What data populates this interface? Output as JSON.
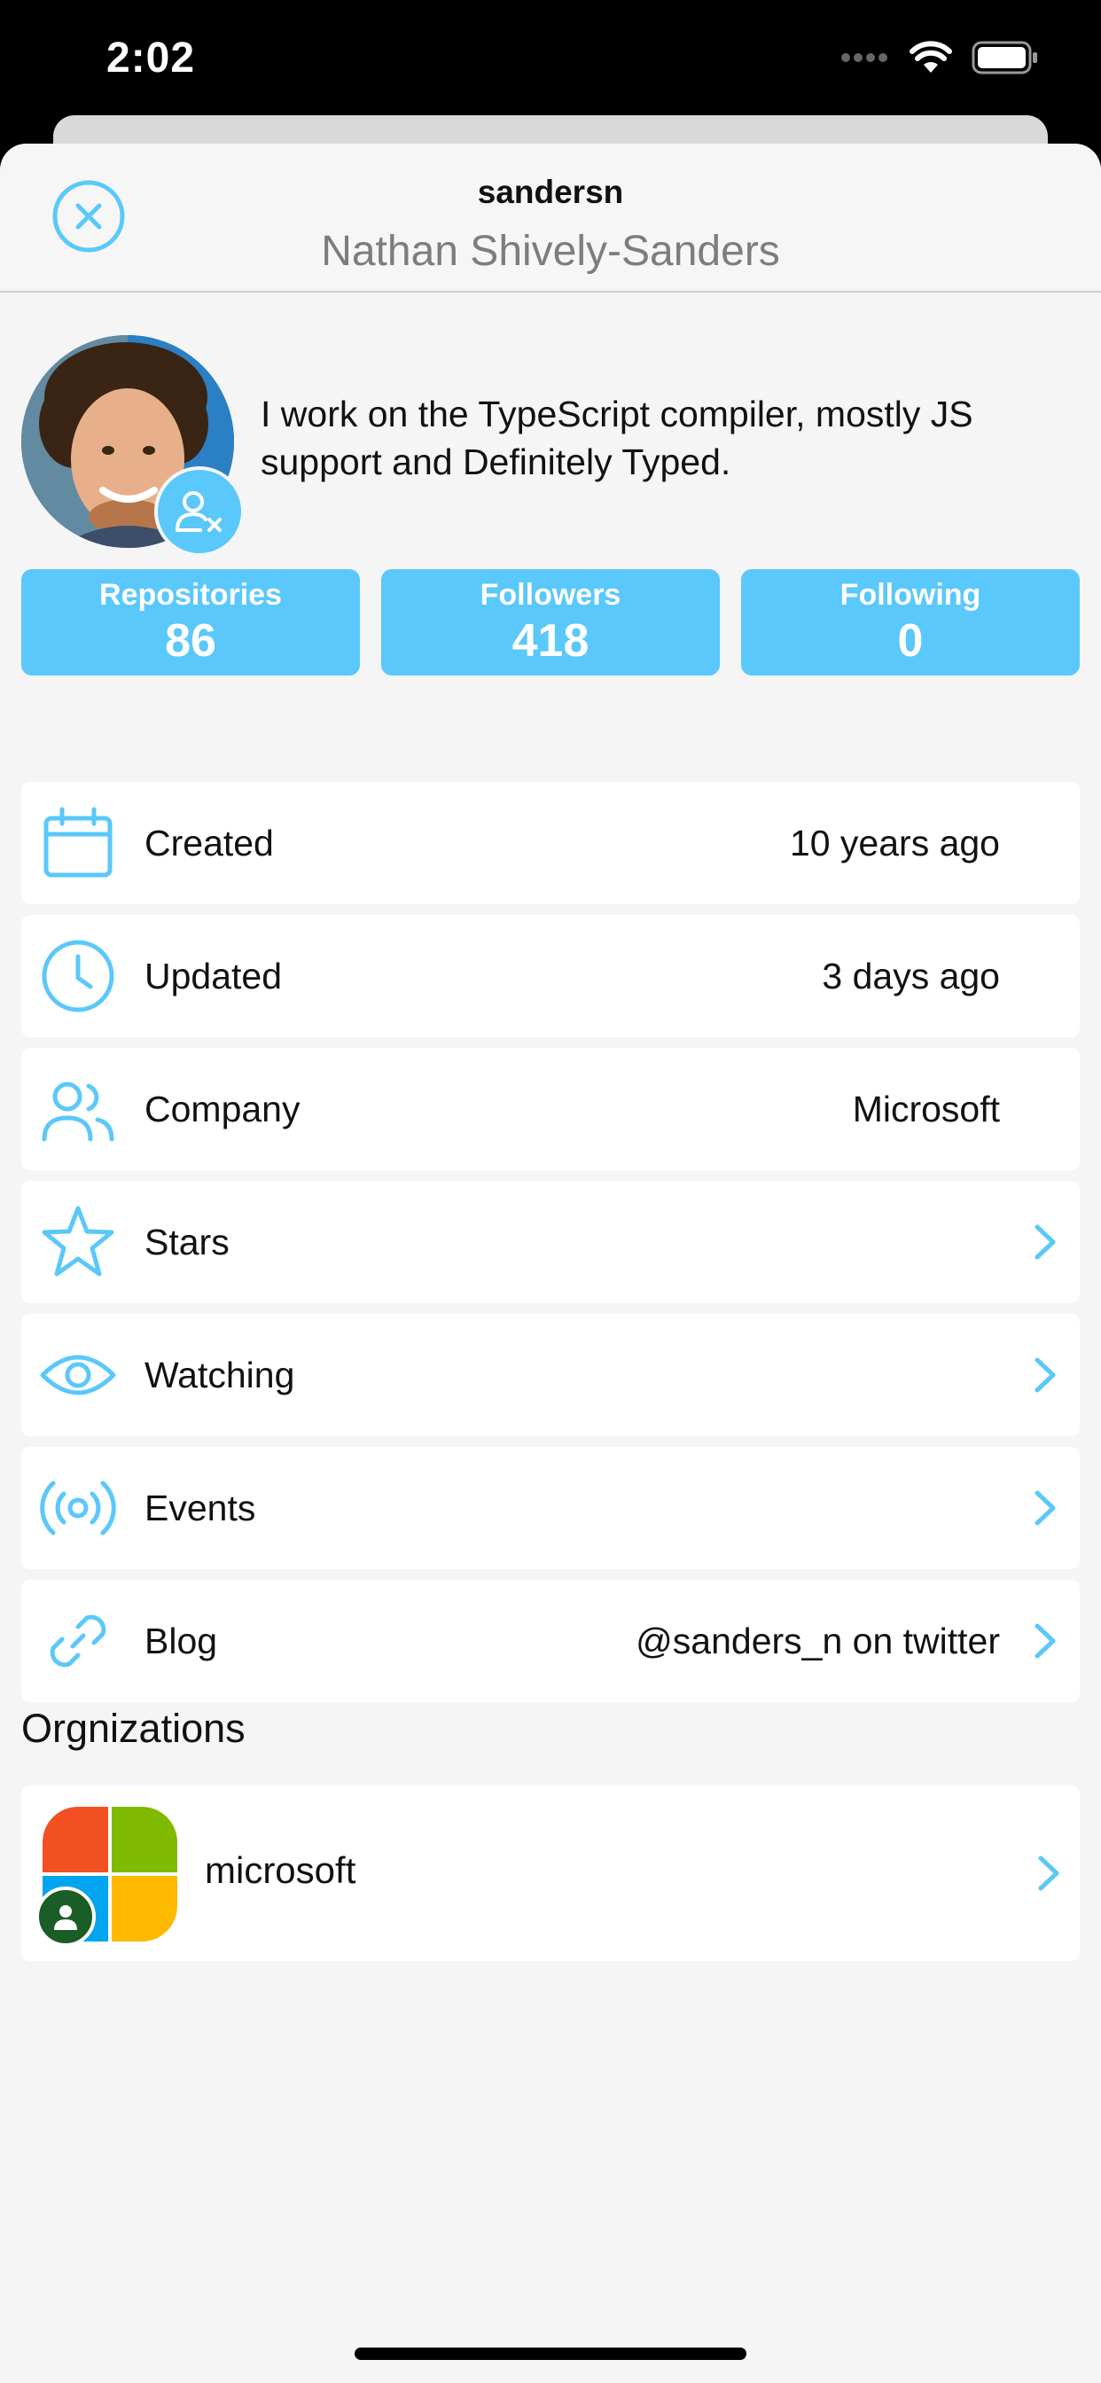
{
  "status_bar": {
    "time": "2:02"
  },
  "header": {
    "username": "sandersn",
    "full_name": "Nathan Shively-Sanders",
    "close_icon": "close-circle-icon"
  },
  "profile": {
    "bio": "I work on the TypeScript compiler, mostly JS support and Definitely Typed.",
    "badge_icon": "unfollow-user-icon"
  },
  "stats": [
    {
      "label": "Repositories",
      "value": "86"
    },
    {
      "label": "Followers",
      "value": "418"
    },
    {
      "label": "Following",
      "value": "0"
    }
  ],
  "details": [
    {
      "icon": "calendar-icon",
      "label": "Created",
      "value": "10 years ago"
    },
    {
      "icon": "clock-icon",
      "label": "Updated",
      "value": "3 days ago"
    },
    {
      "icon": "people-icon",
      "label": "Company",
      "value": "Microsoft"
    },
    {
      "icon": "star-icon",
      "label": "Stars",
      "value": ""
    },
    {
      "icon": "eye-icon",
      "label": "Watching",
      "value": ""
    },
    {
      "icon": "broadcast-icon",
      "label": "Events",
      "value": ""
    },
    {
      "icon": "link-icon",
      "label": "Blog",
      "value": "@sanders_n on twitter"
    }
  ],
  "organizations": {
    "title": "Orgnizations",
    "items": [
      {
        "name": "microsoft"
      }
    ]
  },
  "colors": {
    "accent": "#5ac8fa",
    "background": "#f5f5f5",
    "card": "#ffffff",
    "secondary_text": "#7d7d7d"
  }
}
